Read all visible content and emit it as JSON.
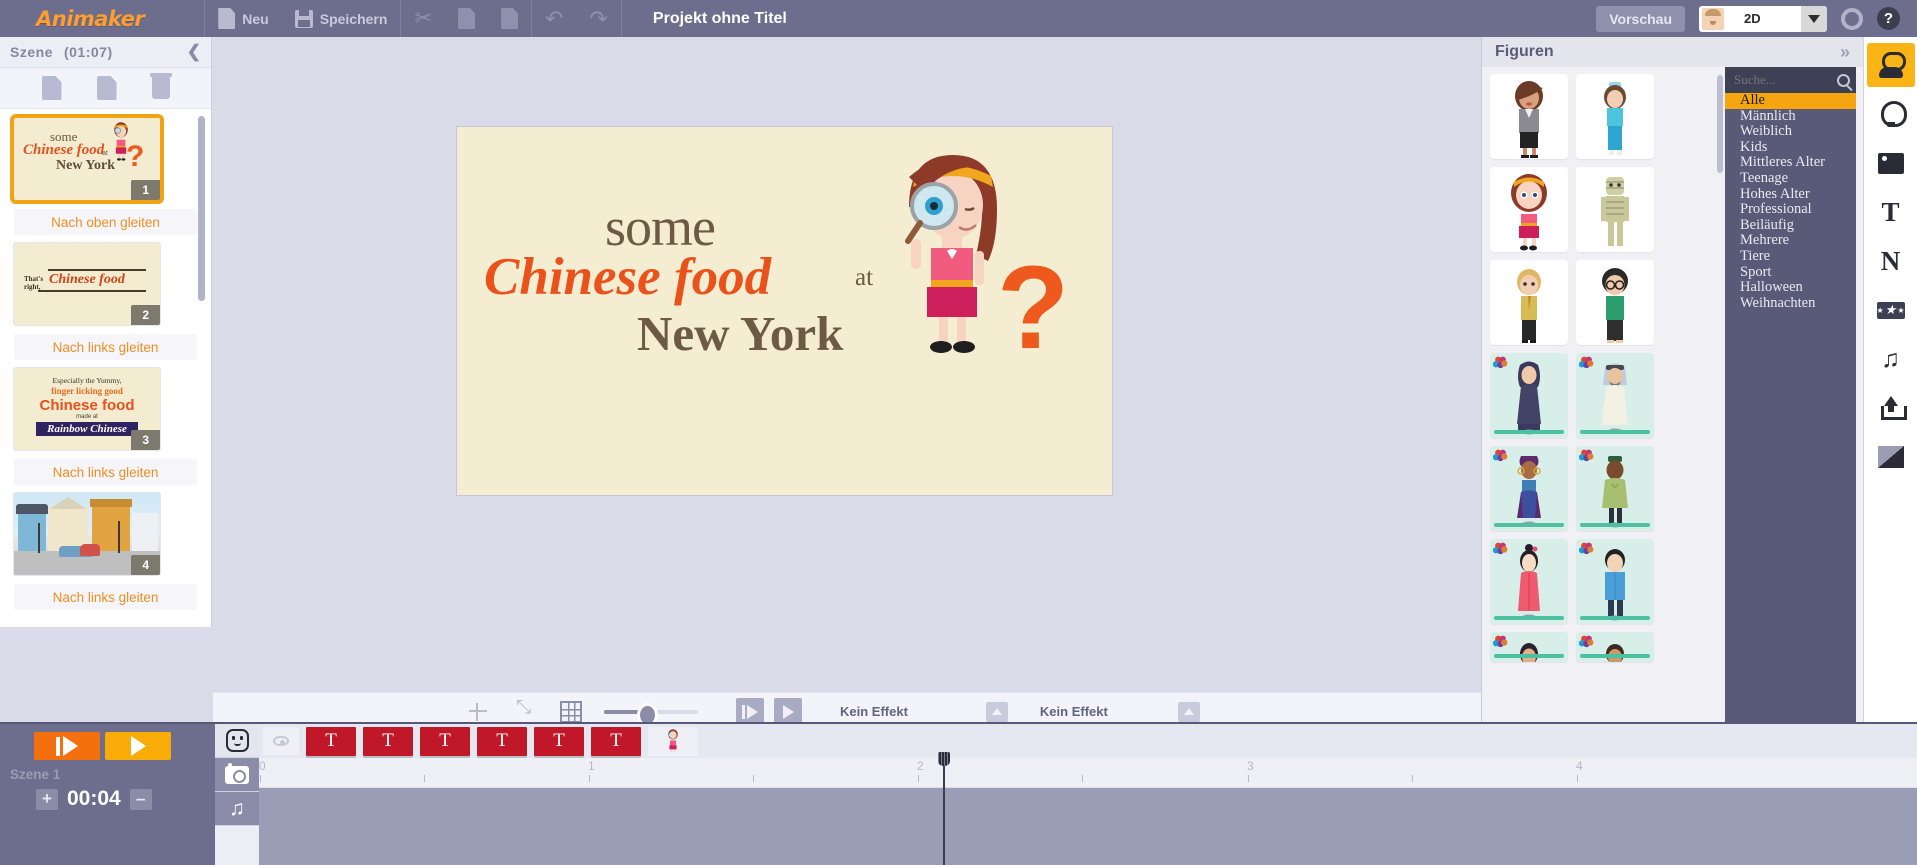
{
  "app": {
    "logo": "Animaker",
    "title": "Projekt ohne Titel"
  },
  "toolbar": {
    "new_label": "Neu",
    "save_label": "Speichern",
    "preview_label": "Vorschau",
    "mode_value": "2D",
    "icons": [
      "new-page-icon",
      "save-icon",
      "cut-icon",
      "copy-icon",
      "paste-icon",
      "undo-icon",
      "redo-icon",
      "gear-icon",
      "help-icon"
    ]
  },
  "scene_panel": {
    "header": "Szene",
    "duration": "(01:07)",
    "collapse_icon": "chevron-left-icon",
    "tools": [
      "add-scene-icon",
      "duplicate-scene-icon",
      "delete-scene-icon"
    ],
    "scenes": [
      {
        "number": "1",
        "selected": true,
        "transition_after": "Nach oben gleiten",
        "text": {
          "some": "some",
          "chinese_food": "Chinese food",
          "at": "at",
          "new_york": "New York",
          "question": "?"
        }
      },
      {
        "number": "2",
        "selected": false,
        "transition_after": "Nach links gleiten",
        "text": {
          "thats": "That's",
          "right": "right,",
          "chinese_food": "Chinese food"
        }
      },
      {
        "number": "3",
        "selected": false,
        "transition_after": "Nach links gleiten",
        "text": {
          "line1": "Especially the Yummy,",
          "line2": "finger licking good",
          "line3": "Chinese food",
          "line4": "made at",
          "line5": "Rainbow Chinese"
        }
      },
      {
        "number": "4",
        "selected": false,
        "transition_after": "Nach links gleiten",
        "text": {}
      }
    ]
  },
  "canvas": {
    "some": "some",
    "chinese_food": "Chinese food",
    "at": "at",
    "new_york": "New York",
    "question": "?",
    "bg_color": "#f5edd1",
    "text_brown": "#6d5a45",
    "text_orange": "#ea511b"
  },
  "canvas_tools": {
    "icons": [
      "center-icon",
      "fit-icon",
      "grid-icon"
    ],
    "zoom_slider_value": 42,
    "play_scene_icon": "play-pause-icon",
    "play_icon": "play-icon",
    "entry_effect": "Kein Effekt",
    "exit_effect": "Kein Effekt",
    "effect_expand_icon": "triangle-up-icon"
  },
  "library": {
    "title": "Figuren",
    "expand_icon": "chevron-double-right-icon",
    "search_placeholder": "Suche...",
    "search_value": "",
    "search_icon": "magnifier-icon",
    "categories": [
      {
        "label": "Alle",
        "active": true
      },
      {
        "label": "Männlich",
        "active": false
      },
      {
        "label": "Weiblich",
        "active": false
      },
      {
        "label": "Kids",
        "active": false
      },
      {
        "label": "Mittleres Alter",
        "active": false
      },
      {
        "label": "Teenage",
        "active": false
      },
      {
        "label": "Hohes Alter",
        "active": false
      },
      {
        "label": "Professional",
        "active": false
      },
      {
        "label": "Beiläufig",
        "active": false
      },
      {
        "label": "Mehrere",
        "active": false
      },
      {
        "label": "Tiere",
        "active": false
      },
      {
        "label": "Sport",
        "active": false
      },
      {
        "label": "Halloween",
        "active": false
      },
      {
        "label": "Weihnachten",
        "active": false
      }
    ],
    "active_category_color": "#f5a50f",
    "characters": [
      {
        "name": "businesswoman-thumbnail",
        "style": "plain"
      },
      {
        "name": "nurse-thumbnail",
        "style": "plain"
      },
      {
        "name": "girl-headband-thumbnail",
        "style": "plain"
      },
      {
        "name": "mummy-thumbnail",
        "style": "plain"
      },
      {
        "name": "blond-man-thumbnail",
        "style": "plain"
      },
      {
        "name": "man-glasses-thumbnail",
        "style": "plain"
      },
      {
        "name": "hijab-woman-thumbnail",
        "style": "teal"
      },
      {
        "name": "arab-man-thumbnail",
        "style": "teal"
      },
      {
        "name": "african-woman-thumbnail",
        "style": "teal"
      },
      {
        "name": "african-man-thumbnail",
        "style": "teal"
      },
      {
        "name": "chinese-woman-thumbnail",
        "style": "teal"
      },
      {
        "name": "asian-man-thumbnail",
        "style": "teal"
      },
      {
        "name": "indian-woman-thumbnail",
        "style": "teal"
      },
      {
        "name": "indian-man-thumbnail",
        "style": "teal"
      }
    ]
  },
  "rail": {
    "items": [
      {
        "name": "characters-tool",
        "icon": "person-icon",
        "active": true
      },
      {
        "name": "properties-tool",
        "icon": "bulb-icon",
        "active": false
      },
      {
        "name": "images-tool",
        "icon": "image-icon",
        "active": false
      },
      {
        "name": "text-tool",
        "icon": "letter-t-icon",
        "label": "T",
        "active": false
      },
      {
        "name": "number-tool",
        "icon": "letter-n-icon",
        "label": "N",
        "active": false
      },
      {
        "name": "effects-tool",
        "icon": "stars-icon",
        "active": false
      },
      {
        "name": "music-tool",
        "icon": "music-note-icon",
        "active": false
      },
      {
        "name": "upload-tool",
        "icon": "upload-icon",
        "active": false
      },
      {
        "name": "background-tool",
        "icon": "half-square-icon",
        "active": false
      }
    ]
  },
  "timeline": {
    "play_all_icon": "play-all-icon",
    "play_icon": "play-icon",
    "scene_label": "Szene 1",
    "time_value": "00:04",
    "plus_label": "+",
    "minus_label": "–",
    "track_icons": [
      "character-track-icon",
      "camera-track-icon",
      "music-track-icon"
    ],
    "visibility_icon": "eye-icon",
    "text_blocks": [
      "T",
      "T",
      "T",
      "T",
      "T",
      "T"
    ],
    "character_block": "character-thumbnail",
    "ruler_labels": [
      "0",
      "1",
      "2",
      "3",
      "4"
    ],
    "playhead_position_seconds": 2.08
  }
}
